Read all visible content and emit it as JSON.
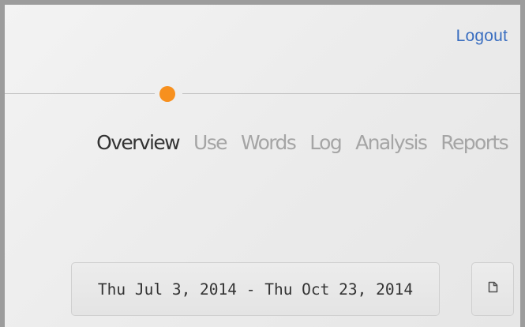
{
  "header": {
    "logout_label": "Logout"
  },
  "progress": {
    "dot_color": "#f7901e"
  },
  "nav": {
    "tabs": [
      {
        "label": "Overview",
        "active": true
      },
      {
        "label": "Use",
        "active": false
      },
      {
        "label": "Words",
        "active": false
      },
      {
        "label": "Log",
        "active": false
      },
      {
        "label": "Analysis",
        "active": false
      },
      {
        "label": "Reports",
        "active": false
      }
    ]
  },
  "date_range": {
    "value": "Thu Jul 3, 2014 - Thu Oct 23, 2014",
    "icon": "calendar-icon"
  },
  "colors": {
    "link": "#3a6ec0",
    "active_tab": "#333333",
    "inactive_tab": "#a5a5a5",
    "accent": "#f7901e"
  }
}
